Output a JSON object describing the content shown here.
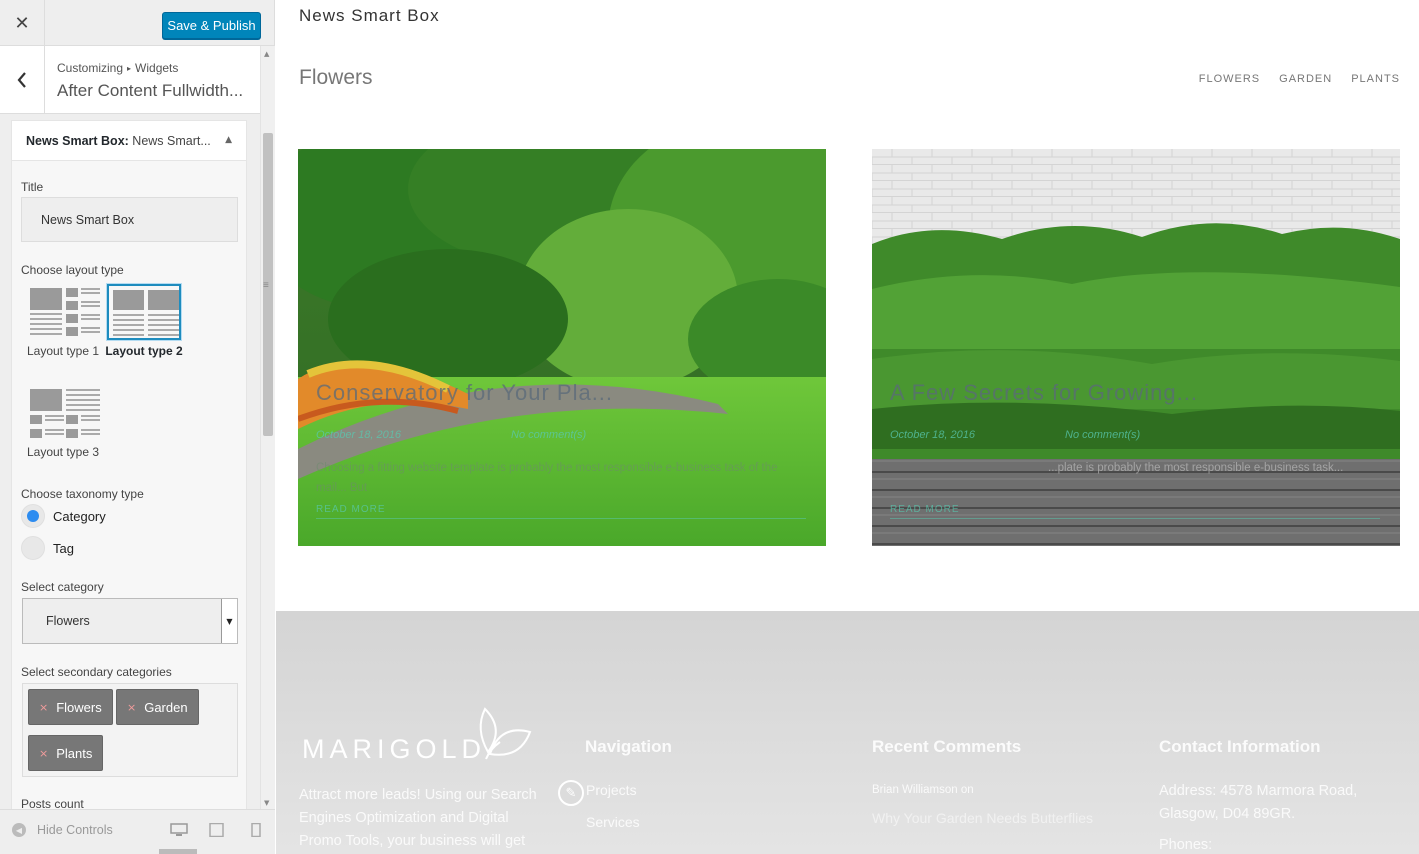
{
  "customizer": {
    "close_label": "✕",
    "publish_label": "Save & Publish",
    "breadcrumb": {
      "first": "Customizing",
      "separator": "▸",
      "second": "Widgets"
    },
    "panel_title": "After Content Fullwidth...",
    "widget": {
      "title_bold": "News Smart Box:",
      "title_rest": " News Smart...",
      "fields": {
        "title_label": "Title",
        "title_value": "News Smart Box",
        "layout_label": "Choose layout type",
        "layouts": [
          "Layout type 1",
          "Layout type 2",
          "Layout type 3"
        ],
        "layout_selected": "Layout type 2",
        "taxonomy_label": "Choose taxonomy type",
        "taxonomy_options": [
          "Category",
          "Tag"
        ],
        "taxonomy_selected": "Category",
        "category_label": "Select category",
        "category_value": "Flowers",
        "secondary_label": "Select secondary categories",
        "secondary_values": [
          "Flowers",
          "Garden",
          "Plants"
        ],
        "posts_count_label": "Posts count"
      }
    },
    "hide_controls_label": "Hide Controls"
  },
  "preview": {
    "widget_title": "News Smart Box",
    "section_title": "Flowers",
    "filters": [
      "FLOWERS",
      "GARDEN",
      "PLANTS"
    ],
    "cards": [
      {
        "title": "Conservatory for Your Pla...",
        "date": "October 18, 2016",
        "author": "",
        "comments": "No comment(s)",
        "excerpt": "Choosing a fitting website template is probably the most responsible e-business task of the mail... But",
        "read_more": "READ MORE"
      },
      {
        "title": "A Few Secrets for Growing...",
        "date": "October 18, 2016",
        "author": "",
        "comments": "No comment(s)",
        "excerpt": "...plate is probably the most responsible e-business task...",
        "read_more": "READ MORE"
      }
    ],
    "footer": {
      "logo_text": "MARIGOLD",
      "about": "Attract more leads! Using our Search Engines Optimization and Digital Promo Tools, your business will get",
      "nav_heading": "Navigation",
      "nav_items": [
        "Projects",
        "Services"
      ],
      "comments_heading": "Recent Comments",
      "comment_author": "Brian Williamson",
      "comment_on": "on",
      "comment_post": "Why Your Garden Needs Butterflies",
      "contact_heading": "Contact Information",
      "address": "Address: 4578 Marmora Road, Glasgow, D04 89GR.",
      "phones": "Phones:"
    }
  },
  "colors": {
    "accent": "#0085ba",
    "radio_on": "#2d8cf0",
    "teal": "#59c9b0"
  }
}
